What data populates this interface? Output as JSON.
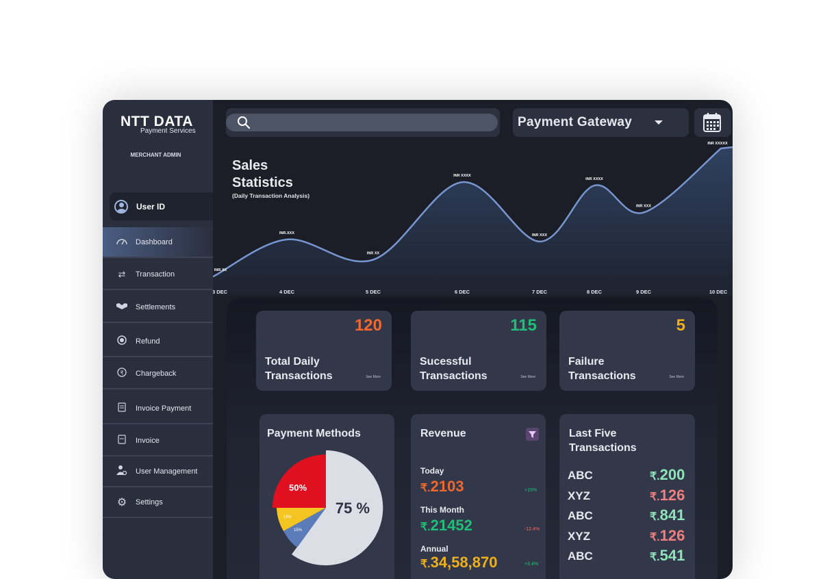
{
  "brand": {
    "logo_text": "NTT DATA",
    "logo_sub": "Payment Services",
    "role": "MERCHANT ADMIN"
  },
  "user": {
    "label": "User ID"
  },
  "sidebar": {
    "items": [
      {
        "label": "Dashboard",
        "icon": "dashboard-icon"
      },
      {
        "label": "Transaction",
        "icon": "transfer-icon"
      },
      {
        "label": "Settlements",
        "icon": "handshake-icon"
      },
      {
        "label": "Refund",
        "icon": "refund-icon"
      },
      {
        "label": "Chargeback",
        "icon": "chargeback-icon"
      },
      {
        "label": "Invoice Payment",
        "icon": "invoice-payment-icon"
      },
      {
        "label": "Invoice",
        "icon": "invoice-icon"
      },
      {
        "label": "User Management",
        "icon": "user-management-icon"
      },
      {
        "label": "Settings",
        "icon": "gear-icon"
      }
    ]
  },
  "search": {
    "placeholder": ""
  },
  "gateway": {
    "selected": "Payment Gateway"
  },
  "sales": {
    "title_line1": "Sales",
    "title_line2": "Statistics",
    "subtitle": "(Daily Transaction Analysis)"
  },
  "chart_data": {
    "type": "area",
    "x": [
      "3 DEC",
      "4 DEC",
      "5 DEC",
      "6 DEC",
      "7 DEC",
      "8 DEC",
      "9 DEC",
      "10 DEC"
    ],
    "point_labels": [
      "INR.XX",
      "INR.XXX",
      "INR XX",
      "INR XXXX",
      "INR XXX",
      "INR XXXX",
      "INR XXX",
      "INR XXXXX"
    ],
    "values": [
      10,
      65,
      35,
      150,
      62,
      145,
      105,
      200
    ],
    "ylim": [
      0,
      210
    ],
    "title": "Sales Statistics",
    "subtitle": "(Daily Transaction Analysis)",
    "grid": false,
    "colors": {
      "line": "#7896cf",
      "fill_top": "#2c3c58",
      "fill_bottom": "#1b1f2a"
    }
  },
  "stats": [
    {
      "value": "120",
      "line1": "Total Daily",
      "line2": "Transactions",
      "link": "See More",
      "color": "#f0682e"
    },
    {
      "value": "115",
      "line1": "Sucessful",
      "line2": "Transactions",
      "link": "See More",
      "color": "#1fbf78"
    },
    {
      "value": "5",
      "line1": "Failure",
      "line2": "Transactions",
      "link": "See More",
      "color": "#f0b01a"
    }
  ],
  "payment_methods": {
    "title": "Payment Methods",
    "slices": [
      {
        "label": "75 %",
        "value": 75,
        "color": "#dcdee5"
      },
      {
        "label": "50%",
        "value": 12.5,
        "color": "#e01020"
      },
      {
        "label": "15%",
        "value": 6,
        "color": "#f4c521"
      },
      {
        "label": "15%",
        "value": 6.5,
        "color": "#5b7cb8"
      }
    ]
  },
  "revenue": {
    "title": "Revenue",
    "currency": "₹.",
    "rows": [
      {
        "label": "Today",
        "value": "2103",
        "pct": "+15%",
        "trend": "pos",
        "color": "#f0682e"
      },
      {
        "label": "This Month",
        "value": "21452",
        "pct": "-12.4%",
        "trend": "neg",
        "color": "#1fbf78"
      },
      {
        "label": "Annual",
        "value": "34,58,870",
        "pct": "+3.4%",
        "trend": "pos",
        "color": "#f0b01a"
      }
    ]
  },
  "last_five": {
    "title_line1": "Last Five",
    "title_line2": "Transactions",
    "rows": [
      {
        "name": "ABC",
        "value": "200",
        "color": "#8fe3b8"
      },
      {
        "name": "XYZ",
        "value": "126",
        "color": "#f07f7f"
      },
      {
        "name": "ABC",
        "value": "841",
        "color": "#8fe3b8"
      },
      {
        "name": "XYZ",
        "value": "126",
        "color": "#f07f7f"
      },
      {
        "name": "ABC",
        "value": "541",
        "color": "#8fe3b8"
      }
    ]
  }
}
